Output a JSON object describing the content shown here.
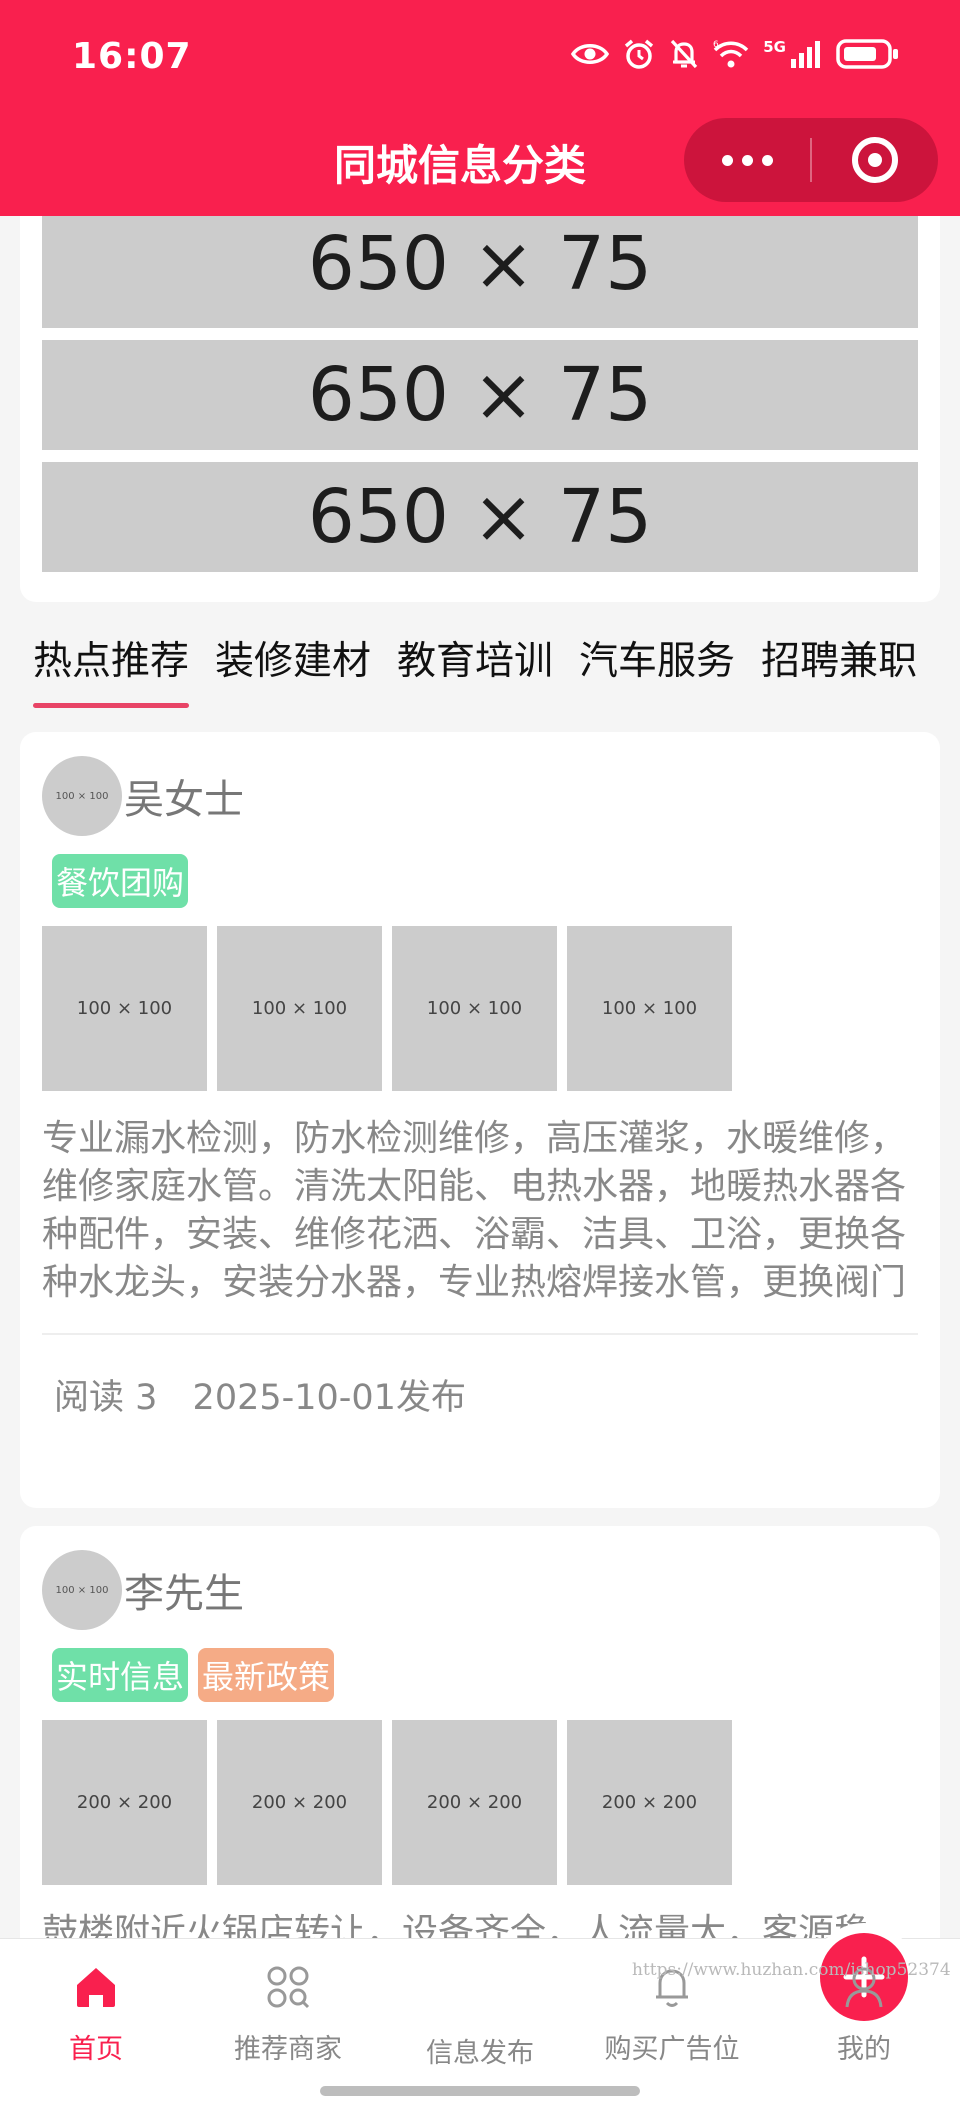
{
  "status_bar": {
    "time": "16:07",
    "signal_label": "5G",
    "icons": [
      "eye-icon",
      "alarm-icon",
      "mute-bell-icon",
      "wifi-icon",
      "signal-icon",
      "battery-icon"
    ]
  },
  "nav_bar": {
    "title": "同城信息分类",
    "menu_icon": "more-dots-icon",
    "close_icon": "target-icon"
  },
  "banners": [
    {
      "label": "650 × 75"
    },
    {
      "label": "650 × 75"
    },
    {
      "label": "650 × 75"
    }
  ],
  "tabs": [
    {
      "label": "热点推荐",
      "active": true
    },
    {
      "label": "装修建材",
      "active": false
    },
    {
      "label": "教育培训",
      "active": false
    },
    {
      "label": "汽车服务",
      "active": false
    },
    {
      "label": "招聘兼职",
      "active": false
    }
  ],
  "posts": [
    {
      "avatar_label": "100 × 100",
      "author": "吴女士",
      "tags": [
        "餐饮团购"
      ],
      "thumbs": [
        "100 × 100",
        "100 × 100",
        "100 × 100",
        "100 × 100"
      ],
      "description": "专业漏水检测，防水检测维修，高压灌浆，水暖维修，维修家庭水管。清洗太阳能、电热水器，地暖热水器各种配件，安装、维修花洒、浴霸、洁具、卫浴，更换各种水龙头，安装分水器，专业热熔焊接水管，更换阀门",
      "reads": "阅读 3",
      "date": "2025-10-01发布"
    },
    {
      "avatar_label": "100 × 100",
      "author": "李先生",
      "tags": [
        "实时信息",
        "最新政策"
      ],
      "thumbs": [
        "200 × 200",
        "200 × 200",
        "200 × 200",
        "200 × 200"
      ],
      "description": "鼓楼附近火锅店转让，设备齐全，人流量大，客源稳"
    }
  ],
  "bottom_nav": [
    {
      "label": "首页",
      "icon": "home-icon",
      "active": true
    },
    {
      "label": "推荐商家",
      "icon": "grid-shop-icon",
      "active": false
    },
    {
      "label": "信息发布",
      "icon": "plus-icon",
      "active": false
    },
    {
      "label": "购买广告位",
      "icon": "bell-icon",
      "active": false
    },
    {
      "label": "我的",
      "icon": "user-icon",
      "active": false
    }
  ],
  "watermark": "https://www.huzhan.com/ishop52374",
  "colors": {
    "brand": "#f9204e",
    "tag_green": "#6fe0a8",
    "tag_orange": "#f5ab86",
    "placeholder_gray": "#cccccc"
  }
}
